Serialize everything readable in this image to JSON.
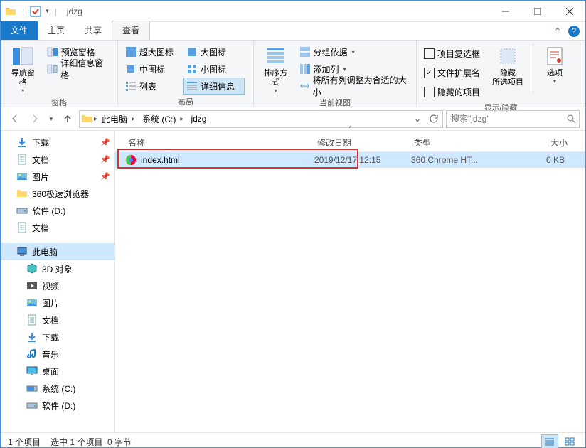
{
  "window": {
    "title": "jdzg"
  },
  "tabs": {
    "file": "文件",
    "home": "主页",
    "share": "共享",
    "view": "查看"
  },
  "ribbon": {
    "panes": {
      "label": "窗格",
      "nav": "导航窗格",
      "preview": "预览窗格",
      "details": "详细信息窗格"
    },
    "layout": {
      "label": "布局",
      "xl": "超大图标",
      "l": "大图标",
      "m": "中图标",
      "s": "小图标",
      "list": "列表",
      "detail": "详细信息"
    },
    "current": {
      "label": "当前视图",
      "sort": "排序方式",
      "group": "分组依据",
      "addcol": "添加列",
      "autosize": "将所有列调整为合适的大小"
    },
    "showhide": {
      "label": "显示/隐藏",
      "chk1": "项目复选框",
      "chk2": "文件扩展名",
      "chk3": "隐藏的项目",
      "hide": "隐藏\n所选项目",
      "options": "选项"
    }
  },
  "address": {
    "crumbs": [
      "此电脑",
      "系统 (C:)",
      "jdzg"
    ]
  },
  "search": {
    "placeholder": "搜索\"jdzg\""
  },
  "tree": [
    {
      "icon": "download",
      "label": "下载",
      "pin": true
    },
    {
      "icon": "doc",
      "label": "文档",
      "pin": true
    },
    {
      "icon": "pic",
      "label": "图片",
      "pin": true
    },
    {
      "icon": "folder",
      "label": "360极速浏览器"
    },
    {
      "icon": "drive",
      "label": "软件 (D:)"
    },
    {
      "icon": "doc",
      "label": "文档"
    },
    {
      "icon": "sep"
    },
    {
      "icon": "pc",
      "label": "此电脑",
      "sel": true
    },
    {
      "icon": "3d",
      "label": "3D 对象",
      "l2": true
    },
    {
      "icon": "video",
      "label": "视频",
      "l2": true
    },
    {
      "icon": "pic",
      "label": "图片",
      "l2": true
    },
    {
      "icon": "doc",
      "label": "文档",
      "l2": true
    },
    {
      "icon": "download",
      "label": "下载",
      "l2": true
    },
    {
      "icon": "music",
      "label": "音乐",
      "l2": true
    },
    {
      "icon": "desktop",
      "label": "桌面",
      "l2": true
    },
    {
      "icon": "drive-c",
      "label": "系统 (C:)",
      "l2": true
    },
    {
      "icon": "drive",
      "label": "软件 (D:)",
      "l2": true
    }
  ],
  "columns": {
    "name": "名称",
    "date": "修改日期",
    "type": "类型",
    "size": "大小"
  },
  "files": [
    {
      "icon": "html",
      "name": "index.html",
      "date": "2019/12/17 12:15",
      "type": "360 Chrome HT...",
      "size": "0 KB"
    }
  ],
  "status": {
    "count": "1 个项目",
    "sel": "选中 1 个项目",
    "bytes": "0 字节"
  }
}
